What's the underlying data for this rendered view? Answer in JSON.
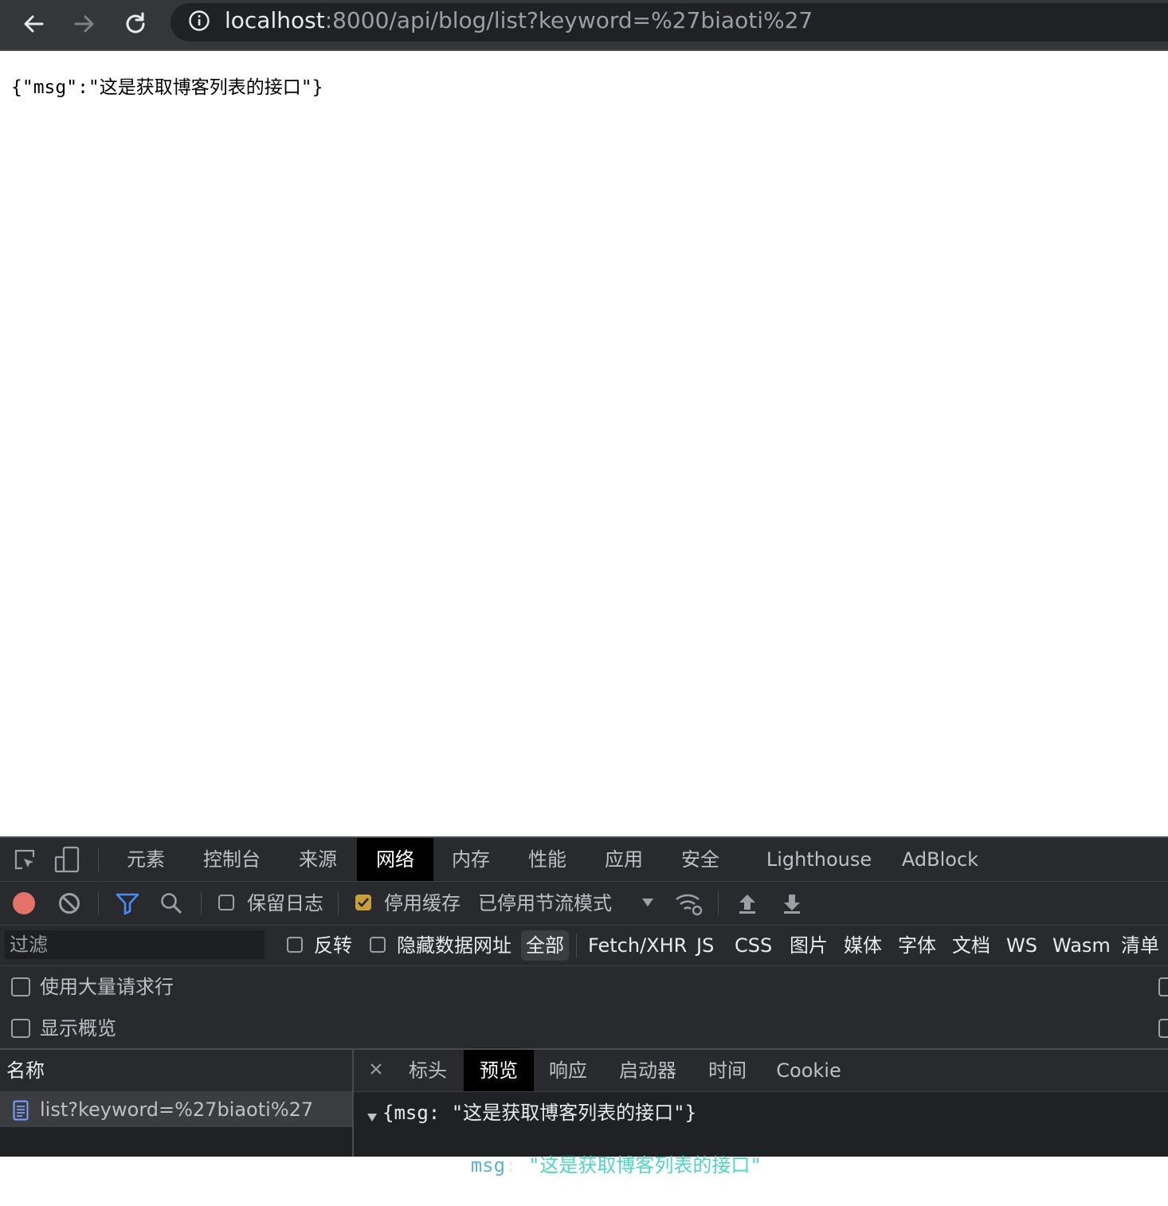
{
  "browser": {
    "url_host": "localhost",
    "url_rest": ":8000/api/blog/list?keyword=%27biaoti%27"
  },
  "page": {
    "body_text": "{\"msg\":\"这是获取博客列表的接口\"}"
  },
  "devtools": {
    "tabs": [
      "元素",
      "控制台",
      "来源",
      "网络",
      "内存",
      "性能",
      "应用",
      "安全",
      "Lighthouse",
      "AdBlock"
    ],
    "active_tab": "网络",
    "toolbar": {
      "preserve_log": "保留日志",
      "disable_cache": "停用缓存",
      "throttling": "已停用节流模式"
    },
    "filter": {
      "placeholder": "过滤",
      "invert": "反转",
      "hide_data_urls": "隐藏数据网址",
      "types": [
        "全部",
        "Fetch/XHR",
        "JS",
        "CSS",
        "图片",
        "媒体",
        "字体",
        "文档",
        "WS",
        "Wasm",
        "清单"
      ],
      "active_type": "全部"
    },
    "options": {
      "large_rows": "使用大量请求行",
      "overview": "显示概览"
    },
    "names": {
      "header": "名称",
      "rows": [
        "list?keyword=%27biaoti%27"
      ]
    },
    "detail": {
      "tabs": [
        "标头",
        "预览",
        "响应",
        "启动器",
        "时间",
        "Cookie"
      ],
      "active_tab": "预览",
      "preview_summary": "{msg: \"这是获取博客列表的接口\"}",
      "preview_key": "msg",
      "preview_value": "\"这是获取博客列表的接口\""
    }
  },
  "colors": {
    "record": "#e37269",
    "checkbox_on": "#c99f3c",
    "json_key": "#5db0d7",
    "json_string": "#4dd6c2",
    "filter_active": "#4b8bf5"
  }
}
